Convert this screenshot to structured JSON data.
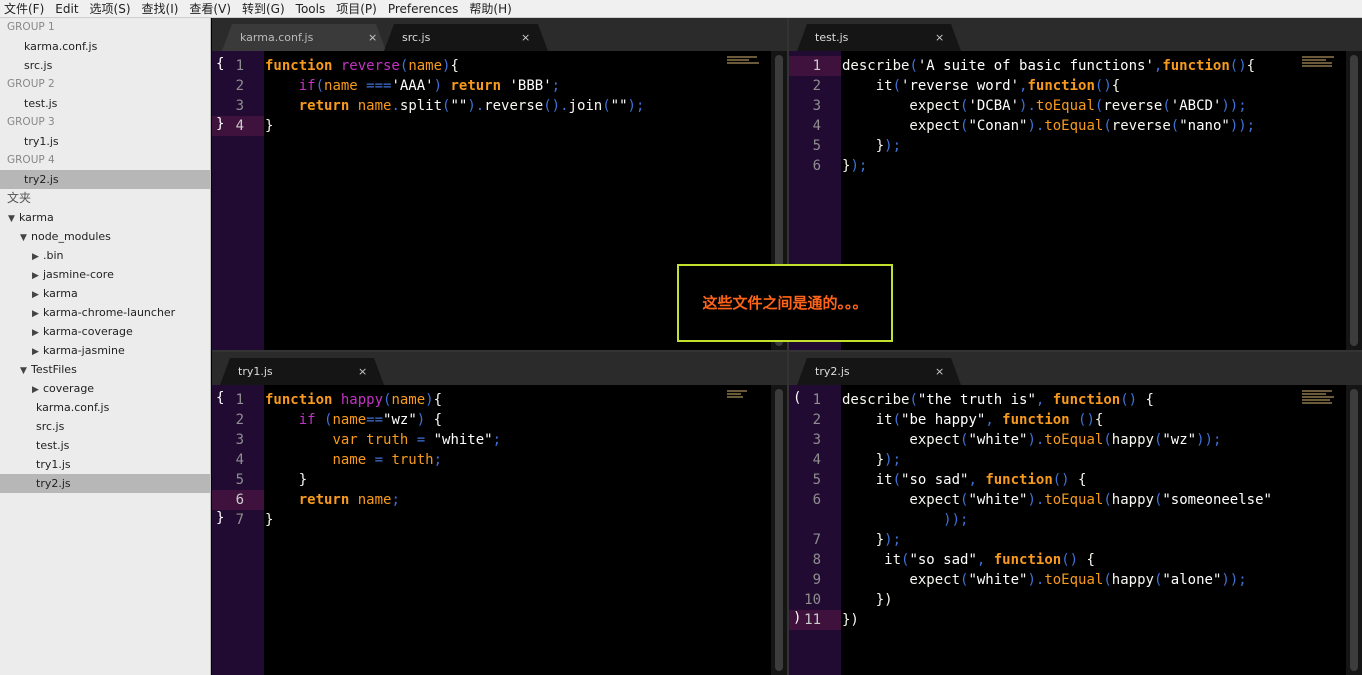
{
  "menu": [
    "文件(F)",
    "Edit",
    "选项(S)",
    "查找(I)",
    "查看(V)",
    "转到(G)",
    "Tools",
    "项目(P)",
    "Preferences",
    "帮助(H)"
  ],
  "sidebar": {
    "groups": [
      {
        "label": "GROUP 1",
        "files": [
          "karma.conf.js",
          "src.js"
        ]
      },
      {
        "label": "GROUP 2",
        "files": [
          "test.js"
        ]
      },
      {
        "label": "GROUP 3",
        "files": [
          "try1.js"
        ]
      },
      {
        "label": "GROUP 4",
        "files": [
          "try2.js"
        ]
      }
    ],
    "folders_label": "文夹",
    "tree": {
      "root": "karma",
      "node_modules": "node_modules",
      "modules": [
        ".bin",
        "jasmine-core",
        "karma",
        "karma-chrome-launcher",
        "karma-coverage",
        "karma-jasmine"
      ],
      "testfiles": "TestFiles",
      "coverage": "coverage",
      "files": [
        "karma.conf.js",
        "src.js",
        "test.js",
        "try1.js",
        "try2.js"
      ]
    }
  },
  "panes": [
    {
      "tabs": [
        {
          "label": "karma.conf.js",
          "close": "×"
        },
        {
          "label": "src.js",
          "close": "×"
        }
      ],
      "lines": [
        "1",
        "2",
        "3",
        "4"
      ],
      "folds": [
        "{",
        "",
        "",
        "}"
      ]
    },
    {
      "tabs": [
        {
          "label": "test.js",
          "close": "×"
        }
      ],
      "lines": [
        "1",
        "2",
        "3",
        "4",
        "5",
        "6"
      ],
      "folds": [
        "",
        "",
        "",
        "",
        "",
        ""
      ]
    },
    {
      "tabs": [
        {
          "label": "try1.js",
          "close": "×"
        }
      ],
      "lines": [
        "1",
        "2",
        "3",
        "4",
        "5",
        "6",
        "7"
      ],
      "folds": [
        "{",
        "",
        "",
        "",
        "",
        "",
        "}"
      ]
    },
    {
      "tabs": [
        {
          "label": "try2.js",
          "close": "×"
        }
      ],
      "lines": [
        "1",
        "2",
        "3",
        "4",
        "5",
        "6",
        "",
        "7",
        "8",
        "9",
        "10",
        "11"
      ],
      "folds": [
        "(",
        "",
        "",
        "",
        "",
        "",
        "",
        "",
        "",
        "",
        "",
        ")"
      ]
    }
  ],
  "code": {
    "p0": [
      [
        [
          "kw",
          "function "
        ],
        [
          "fn",
          "reverse"
        ],
        [
          "op",
          "("
        ],
        [
          "pm",
          "name"
        ],
        [
          "op",
          ")"
        ],
        [
          "",
          "{"
        ]
      ],
      [
        [
          "",
          "    "
        ],
        [
          "ctl",
          "if"
        ],
        [
          "op",
          "("
        ],
        [
          "pm",
          "name"
        ],
        [
          "op",
          " ==="
        ],
        [
          "str",
          "'AAA'"
        ],
        [
          "op",
          ") "
        ],
        [
          "kw",
          "return "
        ],
        [
          "str",
          "'BBB'"
        ],
        [
          "op",
          ";"
        ]
      ],
      [
        [
          "",
          "    "
        ],
        [
          "kw",
          "return "
        ],
        [
          "pm",
          "name"
        ],
        [
          "op",
          "."
        ],
        [
          "",
          "split"
        ],
        [
          "op",
          "("
        ],
        [
          "str",
          "\"\""
        ],
        [
          "op",
          ")."
        ],
        [
          "",
          "reverse"
        ],
        [
          "op",
          "()."
        ],
        [
          "",
          "join"
        ],
        [
          "op",
          "("
        ],
        [
          "str",
          "\"\""
        ],
        [
          "op",
          ");"
        ]
      ],
      [
        [
          "",
          "}"
        ]
      ]
    ],
    "p1": [
      [
        [
          "",
          "describe"
        ],
        [
          "op",
          "("
        ],
        [
          "str",
          "'A suite of basic functions'"
        ],
        [
          "op",
          ","
        ],
        [
          "kw",
          "function"
        ],
        [
          "op",
          "()"
        ],
        [
          "",
          "{"
        ]
      ],
      [
        [
          "",
          "    it"
        ],
        [
          "op",
          "("
        ],
        [
          "str",
          "'reverse word'"
        ],
        [
          "op",
          ","
        ],
        [
          "kw",
          "function"
        ],
        [
          "op",
          "()"
        ],
        [
          "",
          "{"
        ]
      ],
      [
        [
          "",
          "        expect"
        ],
        [
          "op",
          "("
        ],
        [
          "str",
          "'DCBA'"
        ],
        [
          "op",
          ")."
        ],
        [
          "mth",
          "toEqual"
        ],
        [
          "op",
          "("
        ],
        [
          "",
          "reverse"
        ],
        [
          "op",
          "("
        ],
        [
          "str",
          "'ABCD'"
        ],
        [
          "op",
          "));"
        ]
      ],
      [
        [
          "",
          "        expect"
        ],
        [
          "op",
          "("
        ],
        [
          "str",
          "\"Conan\""
        ],
        [
          "op",
          ")."
        ],
        [
          "mth",
          "toEqual"
        ],
        [
          "op",
          "("
        ],
        [
          "",
          "reverse"
        ],
        [
          "op",
          "("
        ],
        [
          "str",
          "\"nano\""
        ],
        [
          "op",
          "));"
        ]
      ],
      [
        [
          "",
          "    }"
        ],
        [
          "op",
          ");"
        ]
      ],
      [
        [
          "",
          "}"
        ],
        [
          "op",
          ");"
        ]
      ]
    ],
    "p2": [
      [
        [
          "kw",
          "function "
        ],
        [
          "fn",
          "happy"
        ],
        [
          "op",
          "("
        ],
        [
          "pm",
          "name"
        ],
        [
          "op",
          ")"
        ],
        [
          "",
          "{"
        ]
      ],
      [
        [
          "",
          "    "
        ],
        [
          "ctl",
          "if "
        ],
        [
          "op",
          "("
        ],
        [
          "pm",
          "name"
        ],
        [
          "op",
          "=="
        ],
        [
          "str",
          "\"wz\""
        ],
        [
          "op",
          ") "
        ],
        [
          "",
          "{"
        ]
      ],
      [
        [
          "",
          "        "
        ],
        [
          "pm",
          "var truth "
        ],
        [
          "op",
          "= "
        ],
        [
          "str",
          "\"white\""
        ],
        [
          "op",
          ";"
        ]
      ],
      [
        [
          "",
          "        "
        ],
        [
          "pm",
          "name "
        ],
        [
          "op",
          "= "
        ],
        [
          "pm",
          "truth"
        ],
        [
          "op",
          ";"
        ]
      ],
      [
        [
          "",
          "    }"
        ]
      ],
      [
        [
          "",
          "    "
        ],
        [
          "kw",
          "return "
        ],
        [
          "pm",
          "name"
        ],
        [
          "op",
          ";"
        ]
      ],
      [
        [
          "",
          "}"
        ]
      ]
    ],
    "p3": [
      [
        [
          "",
          "describe"
        ],
        [
          "op",
          "("
        ],
        [
          "str",
          "\"the truth is\""
        ],
        [
          "op",
          ", "
        ],
        [
          "kw",
          "function"
        ],
        [
          "op",
          "() "
        ],
        [
          "",
          "{"
        ]
      ],
      [
        [
          "",
          "    it"
        ],
        [
          "op",
          "("
        ],
        [
          "str",
          "\"be happy\""
        ],
        [
          "op",
          ", "
        ],
        [
          "kw",
          "function "
        ],
        [
          "op",
          "()"
        ],
        [
          "",
          "{"
        ]
      ],
      [
        [
          "",
          "        expect"
        ],
        [
          "op",
          "("
        ],
        [
          "str",
          "\"white\""
        ],
        [
          "op",
          ")."
        ],
        [
          "mth",
          "toEqual"
        ],
        [
          "op",
          "("
        ],
        [
          "",
          "happy"
        ],
        [
          "op",
          "("
        ],
        [
          "str",
          "\"wz\""
        ],
        [
          "op",
          "));"
        ]
      ],
      [
        [
          "",
          "    }"
        ],
        [
          "op",
          ");"
        ]
      ],
      [
        [
          "",
          "    it"
        ],
        [
          "op",
          "("
        ],
        [
          "str",
          "\"so sad\""
        ],
        [
          "op",
          ", "
        ],
        [
          "kw",
          "function"
        ],
        [
          "op",
          "() "
        ],
        [
          "",
          "{"
        ]
      ],
      [
        [
          "",
          "        expect"
        ],
        [
          "op",
          "("
        ],
        [
          "str",
          "\"white\""
        ],
        [
          "op",
          ")."
        ],
        [
          "mth",
          "toEqual"
        ],
        [
          "op",
          "("
        ],
        [
          "",
          "happy"
        ],
        [
          "op",
          "("
        ],
        [
          "str",
          "\"someoneelse\""
        ]
      ],
      [
        [
          "op",
          "            ));"
        ]
      ],
      [
        [
          "",
          "    }"
        ],
        [
          "op",
          ");"
        ]
      ],
      [
        [
          "",
          "     it"
        ],
        [
          "op",
          "("
        ],
        [
          "str",
          "\"so sad\""
        ],
        [
          "op",
          ", "
        ],
        [
          "kw",
          "function"
        ],
        [
          "op",
          "() "
        ],
        [
          "",
          "{"
        ]
      ],
      [
        [
          "",
          "        expect"
        ],
        [
          "op",
          "("
        ],
        [
          "str",
          "\"white\""
        ],
        [
          "op",
          ")."
        ],
        [
          "mth",
          "toEqual"
        ],
        [
          "op",
          "("
        ],
        [
          "",
          "happy"
        ],
        [
          "op",
          "("
        ],
        [
          "str",
          "\"alone\""
        ],
        [
          "op",
          "));"
        ]
      ],
      [
        [
          "",
          "    })"
        ]
      ],
      [
        [
          "",
          "})"
        ]
      ]
    ]
  },
  "callout": "这些文件之间是通的。。。"
}
